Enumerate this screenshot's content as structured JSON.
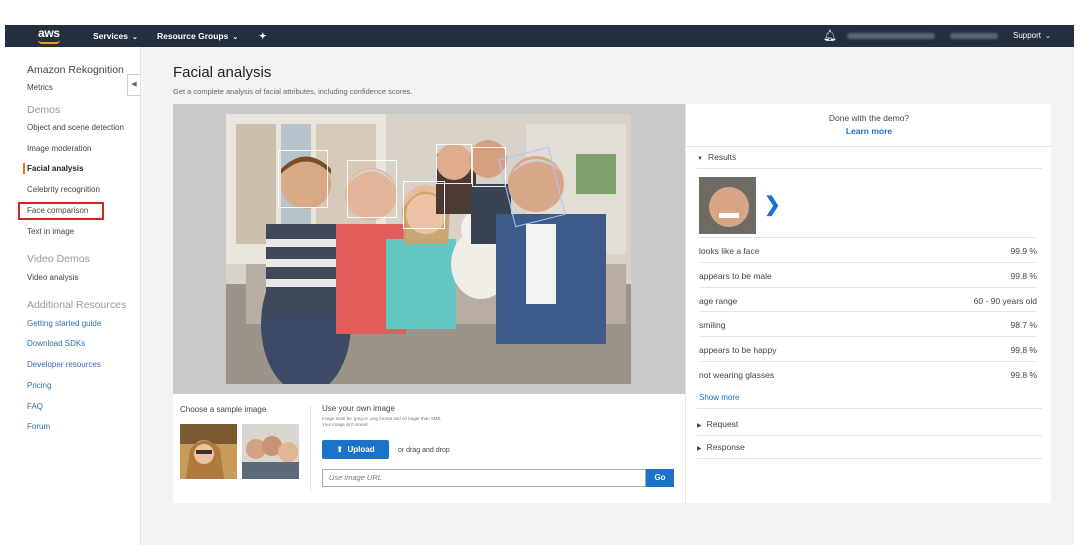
{
  "topbar": {
    "logo": "aws",
    "services": "Services",
    "resource_groups": "Resource Groups",
    "support": "Support",
    "icons": [
      "caret-down-icon",
      "pin-icon",
      "bell-icon"
    ]
  },
  "sidebar": {
    "title": "Amazon Rekognition",
    "metrics": "Metrics",
    "demos_header": "Demos",
    "demos": [
      "Object and scene detection",
      "Image moderation",
      "Facial analysis",
      "Celebrity recognition",
      "Face comparison",
      "Text in image"
    ],
    "active": "Facial analysis",
    "video_header": "Video Demos",
    "video_items": [
      "Video analysis"
    ],
    "resources_header": "Additional Resources",
    "resources": [
      "Getting started guide",
      "Download SDKs",
      "Developer resources",
      "Pricing",
      "FAQ",
      "Forum"
    ]
  },
  "main": {
    "title": "Facial analysis",
    "subtitle": "Get a complete analysis of facial attributes, including confidence scores."
  },
  "sample": {
    "choose": "Choose a sample image",
    "own": "Use your own image",
    "note": "Image must be .jpeg or .png format and no larger than 5MB. Your image isn't stored.",
    "upload": "Upload",
    "drag": "or drag and drop",
    "url_placeholder": "Use image URL",
    "go": "Go"
  },
  "results": {
    "done": "Done with the demo?",
    "learn_more": "Learn more",
    "results_header": "Results",
    "rows": [
      {
        "label": "looks like a face",
        "value": "99.9 %"
      },
      {
        "label": "appears to be male",
        "value": "99.8 %"
      },
      {
        "label": "age range",
        "value": "60 - 90 years old"
      },
      {
        "label": "smiling",
        "value": "98.7 %"
      },
      {
        "label": "appears to be happy",
        "value": "99.8 %"
      },
      {
        "label": "not wearing glasses",
        "value": "99.8 %"
      }
    ],
    "show_more": "Show more",
    "request": "Request",
    "response": "Response"
  },
  "colors": {
    "nav_bg": "#232f3e",
    "accent": "#ec7211",
    "link": "#1a73c9",
    "highlight_box": "#d0271e"
  }
}
